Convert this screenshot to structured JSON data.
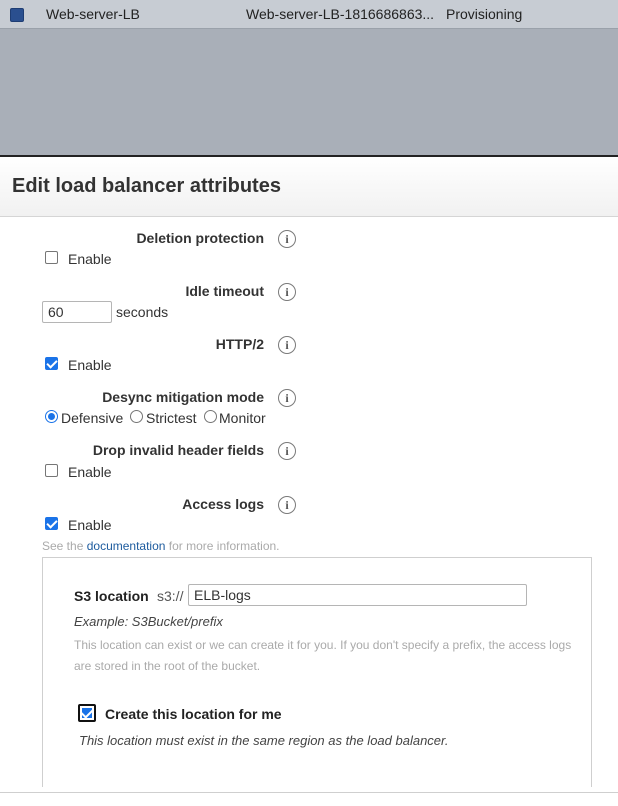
{
  "background_list": {
    "row": {
      "name": "Web-server-LB",
      "dns": "Web-server-LB-1816686863...",
      "state": "Provisioning"
    }
  },
  "modal": {
    "title": "Edit load balancer attributes",
    "deletion_protection": {
      "label": "Deletion protection",
      "option": "Enable",
      "checked": false
    },
    "idle_timeout": {
      "label": "Idle timeout",
      "value": "60",
      "unit": "seconds"
    },
    "http2": {
      "label": "HTTP/2",
      "option": "Enable",
      "checked": true
    },
    "desync": {
      "label": "Desync mitigation mode",
      "options": [
        "Defensive",
        "Strictest",
        "Monitor"
      ],
      "selected": "Defensive"
    },
    "drop_invalid": {
      "label": "Drop invalid header fields",
      "option": "Enable",
      "checked": false
    },
    "access_logs": {
      "label": "Access logs",
      "option": "Enable",
      "checked": true,
      "help_prefix": "See the",
      "help_link": "documentation",
      "help_suffix": "for more information."
    },
    "s3": {
      "label": "S3 location",
      "prefix": "s3://",
      "value": "ELB-logs",
      "example": "Example: S3Bucket/prefix",
      "description_line1": "This location can exist or we can create it for you. If you don't specify a prefix, the access logs",
      "description_line2": "are stored in the root of the bucket.",
      "create_label": "Create this location for me",
      "create_checked": true,
      "region_note": "This location must exist in the same region as the load balancer."
    },
    "info_glyph": "i"
  }
}
